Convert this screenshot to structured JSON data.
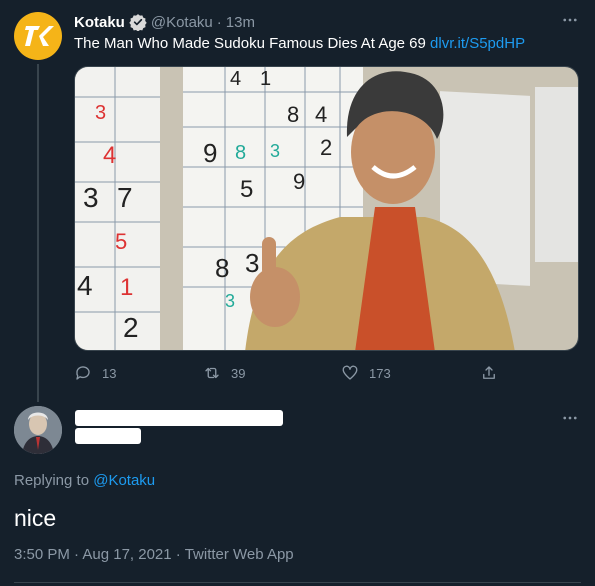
{
  "original_tweet": {
    "display_name": "Kotaku",
    "handle": "@Kotaku",
    "separator": "·",
    "time_ago": "13m",
    "text": "The Man Who Made Sudoku Famous Dies At Age 69",
    "link": "dlvr.it/S5pdHP",
    "avatar_letter": "K",
    "image_alt": "Man smiling with thumbs up in front of sudoku puzzles",
    "actions": {
      "replies": "13",
      "retweets": "39",
      "likes": "173"
    }
  },
  "reply": {
    "replying_to_label": "Replying to",
    "replying_to_handle": "@Kotaku",
    "text": "nice",
    "timestamp": "3:50 PM · Aug 17, 2021",
    "separator": "·",
    "source": "Twitter Web App"
  },
  "colors": {
    "background": "#15202b",
    "accent": "#1d9bf0",
    "muted": "#8b98a5",
    "kotaku_brand": "#f5b418"
  }
}
